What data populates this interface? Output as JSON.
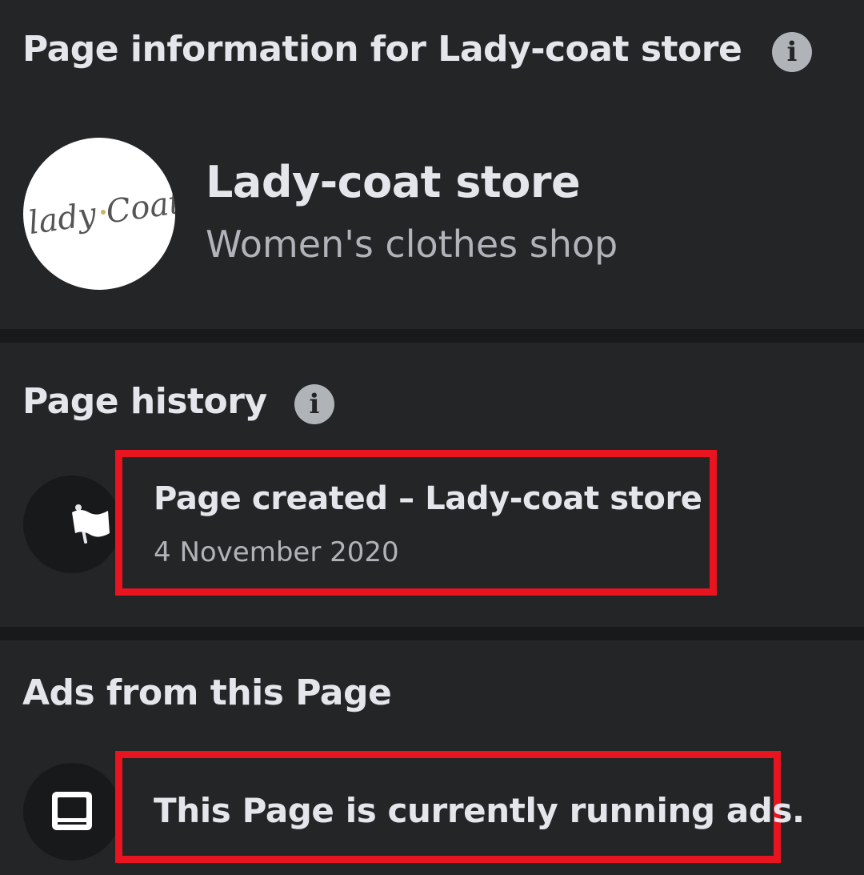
{
  "page_info": {
    "heading": "Page information for Lady-coat store",
    "page_name": "Lady-coat store",
    "category": "Women's clothes shop",
    "logo_text": "lady Coat"
  },
  "page_history": {
    "heading": "Page history",
    "event_title": "Page created – Lady-coat store",
    "event_date": "4 November 2020"
  },
  "ads": {
    "heading": "Ads from this Page",
    "status": "This Page is currently running ads."
  },
  "icons": {
    "info": "info-icon",
    "flag": "flag-icon",
    "ads": "monitor-icon"
  },
  "colors": {
    "background": "#18191a",
    "card": "#242526",
    "primary_text": "#e4e6eb",
    "secondary_text": "#b0b3b8",
    "highlight": "#e8141f"
  }
}
